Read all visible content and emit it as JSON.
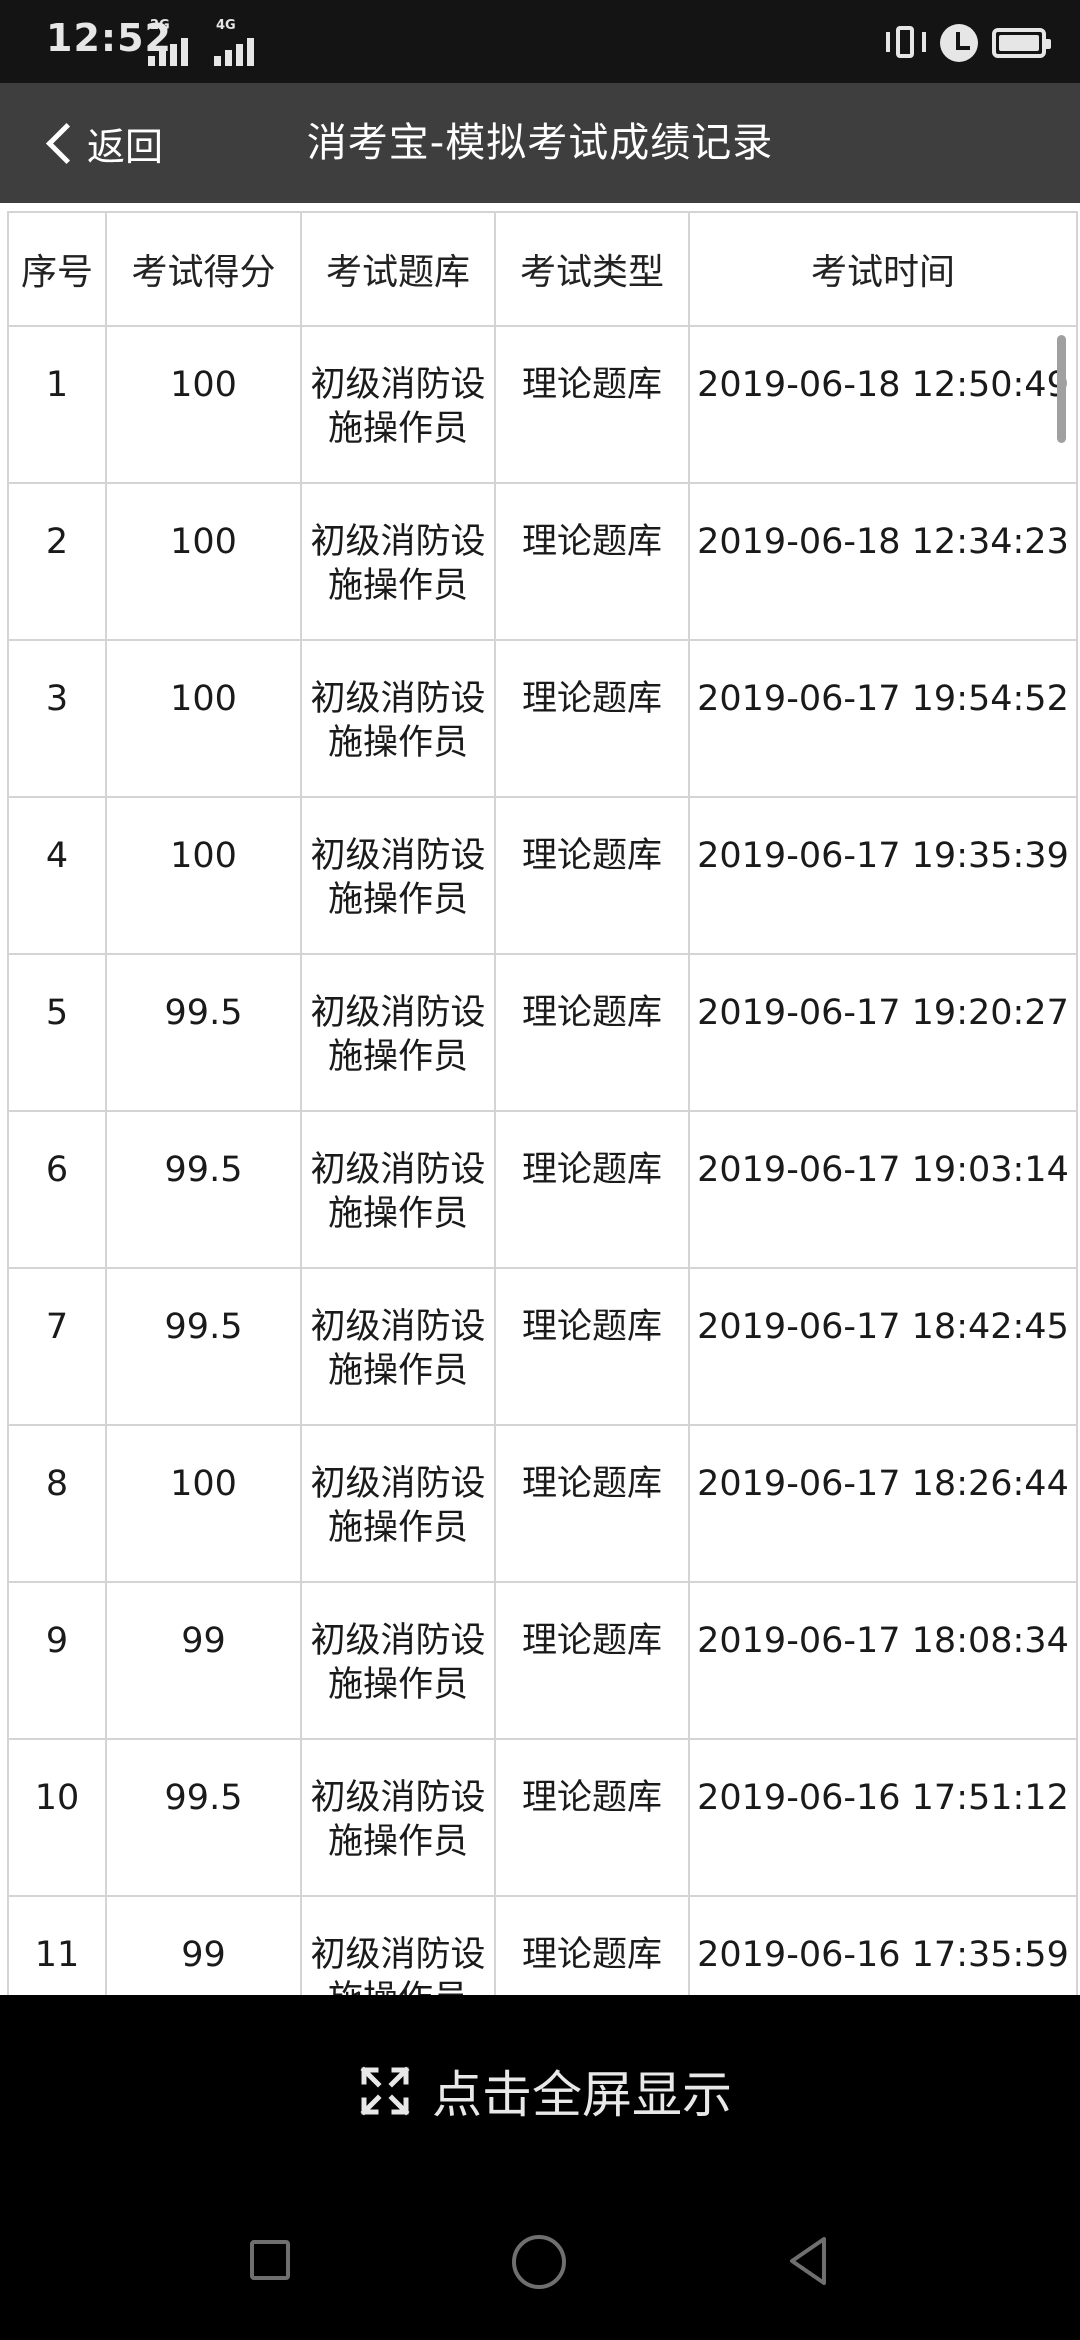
{
  "status_bar": {
    "time": "12:52",
    "network_1": "2G",
    "network_2": "4G"
  },
  "header": {
    "back_label": "返回",
    "title": "消考宝-模拟考试成绩记录"
  },
  "table": {
    "columns": [
      "序号",
      "考试得分",
      "考试题库",
      "考试类型",
      "考试时间"
    ],
    "rows": [
      {
        "no": "1",
        "score": "100",
        "bank": "初级消防设施操作员",
        "type": "理论题库",
        "time": "2019-06-18 12:50:49"
      },
      {
        "no": "2",
        "score": "100",
        "bank": "初级消防设施操作员",
        "type": "理论题库",
        "time": "2019-06-18 12:34:23"
      },
      {
        "no": "3",
        "score": "100",
        "bank": "初级消防设施操作员",
        "type": "理论题库",
        "time": "2019-06-17 19:54:52"
      },
      {
        "no": "4",
        "score": "100",
        "bank": "初级消防设施操作员",
        "type": "理论题库",
        "time": "2019-06-17 19:35:39"
      },
      {
        "no": "5",
        "score": "99.5",
        "bank": "初级消防设施操作员",
        "type": "理论题库",
        "time": "2019-06-17 19:20:27"
      },
      {
        "no": "6",
        "score": "99.5",
        "bank": "初级消防设施操作员",
        "type": "理论题库",
        "time": "2019-06-17 19:03:14"
      },
      {
        "no": "7",
        "score": "99.5",
        "bank": "初级消防设施操作员",
        "type": "理论题库",
        "time": "2019-06-17 18:42:45"
      },
      {
        "no": "8",
        "score": "100",
        "bank": "初级消防设施操作员",
        "type": "理论题库",
        "time": "2019-06-17 18:26:44"
      },
      {
        "no": "9",
        "score": "99",
        "bank": "初级消防设施操作员",
        "type": "理论题库",
        "time": "2019-06-17 18:08:34"
      },
      {
        "no": "10",
        "score": "99.5",
        "bank": "初级消防设施操作员",
        "type": "理论题库",
        "time": "2019-06-16 17:51:12"
      },
      {
        "no": "11",
        "score": "99",
        "bank": "初级消防设施操作员",
        "type": "理论题库",
        "time": "2019-06-16 17:35:59"
      }
    ]
  },
  "fullscreen": {
    "label": "点击全屏显示",
    "icon": "expand-icon"
  },
  "nav_bar": {
    "icons": [
      "recents-icon",
      "home-icon",
      "back-triangle-icon"
    ]
  }
}
